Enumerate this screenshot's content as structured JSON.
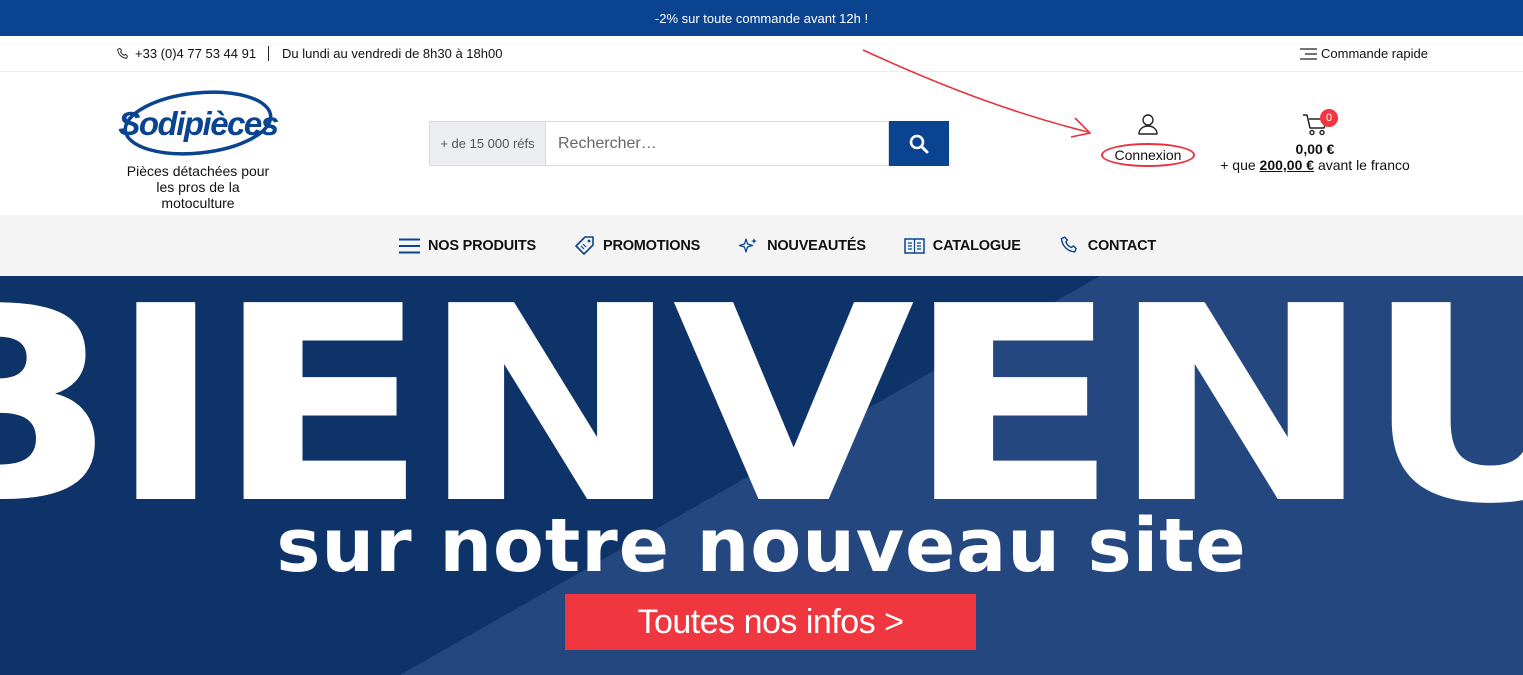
{
  "promo_bar": {
    "text": "-2% sur toute commande avant 12h !"
  },
  "topbar": {
    "phone": "+33 (0)4 77 53 44 91",
    "hours": "Du lundi au vendredi de 8h30 à 18h00",
    "quick_order": "Commande rapide"
  },
  "header": {
    "logo_text": "Sodipièces",
    "tagline": "Pièces détachées pour les pros de la motoculture",
    "search": {
      "refs_label": "+ de 15 000 réfs",
      "placeholder": "Rechercher…",
      "button_icon": "search-icon"
    },
    "account": {
      "label": "Connexion",
      "icon": "user-icon"
    },
    "cart": {
      "count": "0",
      "total": "0,00 €",
      "franco_prefix": "+ que",
      "franco_amount": "200,00 €",
      "franco_suffix": "avant le franco",
      "icon": "cart-icon"
    }
  },
  "nav": {
    "items": [
      {
        "label": "NOS PRODUITS",
        "icon": "menu-icon"
      },
      {
        "label": "PROMOTIONS",
        "icon": "tag-icon"
      },
      {
        "label": "NOUVEAUTÉS",
        "icon": "sparkle-icon"
      },
      {
        "label": "CATALOGUE",
        "icon": "catalog-icon"
      },
      {
        "label": "CONTACT",
        "icon": "phone-icon"
      }
    ]
  },
  "hero": {
    "title": "BIENVENUE",
    "subtitle": "sur notre nouveau site",
    "cta": "Toutes nos infos >"
  },
  "colors": {
    "brand_blue": "#0a4490",
    "accent_red": "#f0363f",
    "hero_dark": "#0e3369",
    "hero_light": "#24477f"
  }
}
